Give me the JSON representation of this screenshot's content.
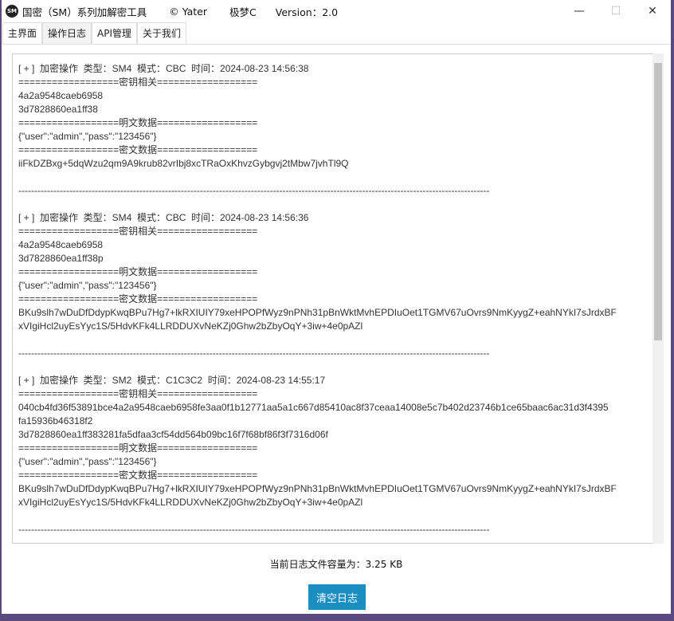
{
  "window": {
    "logo": "SM",
    "title": "国密（SM）系列加解密工具",
    "author": "© Yater",
    "nick": "极梦C",
    "version": "Version：2.0",
    "minimize": "—",
    "maximize": "☐",
    "close": "✕"
  },
  "tabs": [
    {
      "label": "主界面"
    },
    {
      "label": "操作日志",
      "active": true
    },
    {
      "label": "API管理"
    },
    {
      "label": "关于我们"
    }
  ],
  "log": {
    "lines": [
      "[ + ]  加密操作  类型：SM4  模式：CBC  时间：2024-08-23 14:56:38",
      "==================密钥相关==================",
      "4a2a9548caeb6958",
      "3d7828860ea1ff38",
      "==================明文数据==================",
      "{\"user\":\"admin\",\"pass\":\"123456\"}",
      "==================密文数据==================",
      "iiFkDZBxg+5dqWzu2qm9A9krub82vrIbj8xcTRaOxKhvzGybgvj2tMbw7jvhTl9Q",
      "",
      "----------------------------------------------------------------------------------------------------------------------------------------------------",
      "",
      "[ + ]  加密操作  类型：SM4  模式：CBC  时间：2024-08-23 14:56:36",
      "==================密钥相关==================",
      "4a2a9548caeb6958",
      "3d7828860ea1ff38p",
      "==================明文数据==================",
      "{\"user\":\"admin\",\"pass\":\"123456\"}",
      "==================密文数据==================",
      "BKu9slh7wDuDfDdypKwqBPu7Hg7+lkRXIUIY79xeHPOPfWyz9nPNh31pBnWktMvhEPDIuOet1TGMV67uOvrs9NmKyygZ+eahNYkI7sJrdxBF",
      "xVIgiHcl2uyEsYyc1S/5HdvKFk4LLRDDUXvNeKZj0Ghw2bZbyOqY+3iw+4e0pAZl",
      "",
      "----------------------------------------------------------------------------------------------------------------------------------------------------",
      "",
      "[ + ]  加密操作  类型：SM2  模式：C1C3C2  时间：2024-08-23 14:55:17",
      "==================密钥相关==================",
      "040cb4fd36f53891bce4a2a9548caeb6958fe3aa0f1b12771aa5a1c667d85410ac8f37ceaa14008e5c7b402d23746b1ce65baac6ac31d3f4395",
      "fa15936b46318f2",
      "3d7828860ea1ff383281fa5dfaa3cf54dd564b09bc16f7f68bf86f3f7316d06f",
      "==================明文数据==================",
      "{\"user\":\"admin\",\"pass\":\"123456\"}",
      "==================密文数据==================",
      "BKu9slh7wDuDfDdypKwqBPu7Hg7+lkRXIUIY79xeHPOPfWyz9nPNh31pBnWktMvhEPDIuOet1TGMV67uOvrs9NmKyygZ+eahNYkI7sJrdxBF",
      "xVIgiHcl2uyEsYyc1S/5HdvKFk4LLRDDUXvNeKZj0Ghw2bZbyOqY+3iw+4e0pAZl",
      "",
      "----------------------------------------------------------------------------------------------------------------------------------------------------"
    ]
  },
  "status": "当前日志文件容量为：3.25 KB",
  "clear_button": "清空日志",
  "accent": "#1a8ec0"
}
